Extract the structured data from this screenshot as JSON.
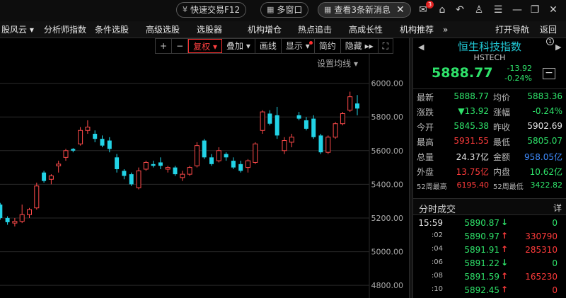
{
  "titlebar": {
    "quick_trade": "快速交易F12",
    "multi_window": "多窗口",
    "new_messages": "查看3条新消息",
    "mail_badge": "3"
  },
  "menubar": {
    "items": [
      "股风云",
      "分析师指数",
      "条件选股",
      "高级选股",
      "选股器",
      "机构增仓",
      "热点追击",
      "高成长性",
      "机构推荐",
      "»",
      "打开导航",
      "返回"
    ]
  },
  "toolbar": {
    "plus": "+",
    "minus": "−",
    "fuquan": "复权",
    "overlay": "叠加",
    "drawline": "画线",
    "display": "显示",
    "simple": "简约",
    "hide": "隐藏",
    "fullscreen": "⛶"
  },
  "chart": {
    "ma_setting": "设置均线",
    "up_color": "#ff4a4a",
    "down_color": "#22d3e6",
    "grid_color": "#2a2a2a"
  },
  "chart_data": {
    "type": "candlestick",
    "y_ticks": [
      "6000.00",
      "5800.00",
      "5600.00",
      "5400.00",
      "5200.00",
      "5000.00",
      "4800.00"
    ],
    "ylim": [
      4725,
      6175
    ],
    "candles": [
      {
        "o": 5280,
        "c": 5200,
        "h": 5290,
        "l": 5190
      },
      {
        "o": 5200,
        "c": 5175,
        "h": 5210,
        "l": 5160
      },
      {
        "o": 5170,
        "c": 5180,
        "h": 5200,
        "l": 5150
      },
      {
        "o": 5180,
        "c": 5220,
        "h": 5280,
        "l": 5170
      },
      {
        "o": 5220,
        "c": 5250,
        "h": 5260,
        "l": 5200
      },
      {
        "o": 5260,
        "c": 5390,
        "h": 5410,
        "l": 5250
      },
      {
        "o": 5470,
        "c": 5420,
        "h": 5480,
        "l": 5410
      },
      {
        "o": 5430,
        "c": 5450,
        "h": 5460,
        "l": 5400
      },
      {
        "o": 5510,
        "c": 5520,
        "h": 5540,
        "l": 5470
      },
      {
        "o": 5560,
        "c": 5600,
        "h": 5610,
        "l": 5540
      },
      {
        "o": 5610,
        "c": 5600,
        "h": 5615,
        "l": 5590
      },
      {
        "o": 5640,
        "c": 5720,
        "h": 5740,
        "l": 5630
      },
      {
        "o": 5720,
        "c": 5740,
        "h": 5780,
        "l": 5700
      },
      {
        "o": 5700,
        "c": 5670,
        "h": 5720,
        "l": 5650
      },
      {
        "o": 5670,
        "c": 5630,
        "h": 5690,
        "l": 5620
      },
      {
        "o": 5660,
        "c": 5610,
        "h": 5680,
        "l": 5590
      },
      {
        "o": 5560,
        "c": 5490,
        "h": 5580,
        "l": 5470
      },
      {
        "o": 5480,
        "c": 5450,
        "h": 5490,
        "l": 5430
      },
      {
        "o": 5460,
        "c": 5400,
        "h": 5470,
        "l": 5390
      },
      {
        "o": 5380,
        "c": 5480,
        "h": 5500,
        "l": 5370
      },
      {
        "o": 5490,
        "c": 5530,
        "h": 5540,
        "l": 5480
      },
      {
        "o": 5520,
        "c": 5510,
        "h": 5540,
        "l": 5500
      },
      {
        "o": 5530,
        "c": 5510,
        "h": 5560,
        "l": 5490
      },
      {
        "o": 5490,
        "c": 5500,
        "h": 5510,
        "l": 5470
      },
      {
        "o": 5500,
        "c": 5460,
        "h": 5510,
        "l": 5450
      },
      {
        "o": 5440,
        "c": 5460,
        "h": 5480,
        "l": 5420
      },
      {
        "o": 5460,
        "c": 5500,
        "h": 5510,
        "l": 5450
      },
      {
        "o": 5510,
        "c": 5630,
        "h": 5650,
        "l": 5500
      },
      {
        "o": 5660,
        "c": 5560,
        "h": 5670,
        "l": 5550
      },
      {
        "o": 5560,
        "c": 5520,
        "h": 5580,
        "l": 5510
      },
      {
        "o": 5540,
        "c": 5600,
        "h": 5620,
        "l": 5530
      },
      {
        "o": 5580,
        "c": 5560,
        "h": 5590,
        "l": 5540
      },
      {
        "o": 5540,
        "c": 5500,
        "h": 5560,
        "l": 5490
      },
      {
        "o": 5520,
        "c": 5480,
        "h": 5540,
        "l": 5470
      },
      {
        "o": 5500,
        "c": 5540,
        "h": 5550,
        "l": 5470
      },
      {
        "o": 5530,
        "c": 5640,
        "h": 5650,
        "l": 5520
      },
      {
        "o": 5720,
        "c": 5830,
        "h": 5840,
        "l": 5700
      },
      {
        "o": 5820,
        "c": 5760,
        "h": 5840,
        "l": 5750
      },
      {
        "o": 5810,
        "c": 5690,
        "h": 5860,
        "l": 5670
      },
      {
        "o": 5600,
        "c": 5660,
        "h": 5680,
        "l": 5580
      },
      {
        "o": 5650,
        "c": 5680,
        "h": 5700,
        "l": 5620
      },
      {
        "o": 5810,
        "c": 5790,
        "h": 5830,
        "l": 5780
      },
      {
        "o": 5780,
        "c": 5730,
        "h": 5800,
        "l": 5720
      },
      {
        "o": 5790,
        "c": 5680,
        "h": 5810,
        "l": 5670
      },
      {
        "o": 5690,
        "c": 5590,
        "h": 5700,
        "l": 5580
      },
      {
        "o": 5590,
        "c": 5680,
        "h": 5690,
        "l": 5580
      },
      {
        "o": 5680,
        "c": 5760,
        "h": 5770,
        "l": 5670
      },
      {
        "o": 5760,
        "c": 5820,
        "h": 5830,
        "l": 5750
      },
      {
        "o": 5840,
        "c": 5920,
        "h": 5950,
        "l": 5830
      },
      {
        "o": 5880,
        "c": 5850,
        "h": 5930,
        "l": 5810
      }
    ]
  },
  "index": {
    "name": "恒生科技指数",
    "code": "HSTECH",
    "price": "5888.77",
    "change": "-13.92",
    "change_pct": "-0.24%",
    "info": "1",
    "minus_btn": "−"
  },
  "quote": [
    {
      "l1": "最新",
      "v1": "5888.77",
      "c1": "green",
      "l2": "均价",
      "v2": "5883.36",
      "c2": "green"
    },
    {
      "l1": "涨跌",
      "v1": "▼13.92",
      "c1": "green",
      "l2": "涨幅",
      "v2": "-0.24%",
      "c2": "green"
    },
    {
      "l1": "今开",
      "v1": "5845.38",
      "c1": "green",
      "l2": "昨收",
      "v2": "5902.69",
      "c2": "white"
    },
    {
      "l1": "最高",
      "v1": "5931.55",
      "c1": "red",
      "l2": "最低",
      "v2": "5805.07",
      "c2": "green"
    },
    {
      "l1": "总量",
      "v1": "24.37亿",
      "c1": "white",
      "l2": "金额",
      "v2": "958.05亿",
      "c2": "blue"
    },
    {
      "l1": "外盘",
      "v1": "13.75亿",
      "c1": "red",
      "l2": "内盘",
      "v2": "10.62亿",
      "c2": "green"
    },
    {
      "l1": "52周最高",
      "v1": "6195.40",
      "c1": "red",
      "l2": "52周最低",
      "v2": "3422.82",
      "c2": "green"
    }
  ],
  "ticks_panel": {
    "title": "分时成交",
    "detail": "详",
    "rows": [
      {
        "time": "15:59",
        "price": "5890.87",
        "dir": "down",
        "vol": "0"
      },
      {
        "time": ":02",
        "price": "5890.97",
        "dir": "up",
        "vol": "330790"
      },
      {
        "time": ":04",
        "price": "5891.91",
        "dir": "up",
        "vol": "285310"
      },
      {
        "time": ":06",
        "price": "5891.22",
        "dir": "down",
        "vol": "0"
      },
      {
        "time": ":08",
        "price": "5891.59",
        "dir": "up",
        "vol": "165230"
      },
      {
        "time": ":10",
        "price": "5892.45",
        "dir": "up",
        "vol": "0"
      }
    ]
  }
}
